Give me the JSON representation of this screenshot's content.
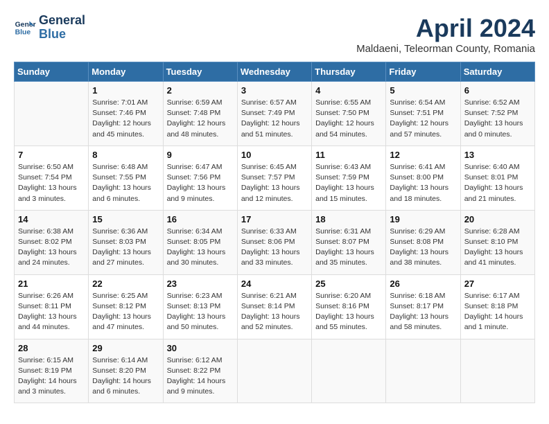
{
  "logo": {
    "line1": "General",
    "line2": "Blue"
  },
  "title": "April 2024",
  "subtitle": "Maldaeni, Teleorman County, Romania",
  "days_header": [
    "Sunday",
    "Monday",
    "Tuesday",
    "Wednesday",
    "Thursday",
    "Friday",
    "Saturday"
  ],
  "weeks": [
    [
      {
        "day": "",
        "info": ""
      },
      {
        "day": "1",
        "info": "Sunrise: 7:01 AM\nSunset: 7:46 PM\nDaylight: 12 hours\nand 45 minutes."
      },
      {
        "day": "2",
        "info": "Sunrise: 6:59 AM\nSunset: 7:48 PM\nDaylight: 12 hours\nand 48 minutes."
      },
      {
        "day": "3",
        "info": "Sunrise: 6:57 AM\nSunset: 7:49 PM\nDaylight: 12 hours\nand 51 minutes."
      },
      {
        "day": "4",
        "info": "Sunrise: 6:55 AM\nSunset: 7:50 PM\nDaylight: 12 hours\nand 54 minutes."
      },
      {
        "day": "5",
        "info": "Sunrise: 6:54 AM\nSunset: 7:51 PM\nDaylight: 12 hours\nand 57 minutes."
      },
      {
        "day": "6",
        "info": "Sunrise: 6:52 AM\nSunset: 7:52 PM\nDaylight: 13 hours\nand 0 minutes."
      }
    ],
    [
      {
        "day": "7",
        "info": "Sunrise: 6:50 AM\nSunset: 7:54 PM\nDaylight: 13 hours\nand 3 minutes."
      },
      {
        "day": "8",
        "info": "Sunrise: 6:48 AM\nSunset: 7:55 PM\nDaylight: 13 hours\nand 6 minutes."
      },
      {
        "day": "9",
        "info": "Sunrise: 6:47 AM\nSunset: 7:56 PM\nDaylight: 13 hours\nand 9 minutes."
      },
      {
        "day": "10",
        "info": "Sunrise: 6:45 AM\nSunset: 7:57 PM\nDaylight: 13 hours\nand 12 minutes."
      },
      {
        "day": "11",
        "info": "Sunrise: 6:43 AM\nSunset: 7:59 PM\nDaylight: 13 hours\nand 15 minutes."
      },
      {
        "day": "12",
        "info": "Sunrise: 6:41 AM\nSunset: 8:00 PM\nDaylight: 13 hours\nand 18 minutes."
      },
      {
        "day": "13",
        "info": "Sunrise: 6:40 AM\nSunset: 8:01 PM\nDaylight: 13 hours\nand 21 minutes."
      }
    ],
    [
      {
        "day": "14",
        "info": "Sunrise: 6:38 AM\nSunset: 8:02 PM\nDaylight: 13 hours\nand 24 minutes."
      },
      {
        "day": "15",
        "info": "Sunrise: 6:36 AM\nSunset: 8:03 PM\nDaylight: 13 hours\nand 27 minutes."
      },
      {
        "day": "16",
        "info": "Sunrise: 6:34 AM\nSunset: 8:05 PM\nDaylight: 13 hours\nand 30 minutes."
      },
      {
        "day": "17",
        "info": "Sunrise: 6:33 AM\nSunset: 8:06 PM\nDaylight: 13 hours\nand 33 minutes."
      },
      {
        "day": "18",
        "info": "Sunrise: 6:31 AM\nSunset: 8:07 PM\nDaylight: 13 hours\nand 35 minutes."
      },
      {
        "day": "19",
        "info": "Sunrise: 6:29 AM\nSunset: 8:08 PM\nDaylight: 13 hours\nand 38 minutes."
      },
      {
        "day": "20",
        "info": "Sunrise: 6:28 AM\nSunset: 8:10 PM\nDaylight: 13 hours\nand 41 minutes."
      }
    ],
    [
      {
        "day": "21",
        "info": "Sunrise: 6:26 AM\nSunset: 8:11 PM\nDaylight: 13 hours\nand 44 minutes."
      },
      {
        "day": "22",
        "info": "Sunrise: 6:25 AM\nSunset: 8:12 PM\nDaylight: 13 hours\nand 47 minutes."
      },
      {
        "day": "23",
        "info": "Sunrise: 6:23 AM\nSunset: 8:13 PM\nDaylight: 13 hours\nand 50 minutes."
      },
      {
        "day": "24",
        "info": "Sunrise: 6:21 AM\nSunset: 8:14 PM\nDaylight: 13 hours\nand 52 minutes."
      },
      {
        "day": "25",
        "info": "Sunrise: 6:20 AM\nSunset: 8:16 PM\nDaylight: 13 hours\nand 55 minutes."
      },
      {
        "day": "26",
        "info": "Sunrise: 6:18 AM\nSunset: 8:17 PM\nDaylight: 13 hours\nand 58 minutes."
      },
      {
        "day": "27",
        "info": "Sunrise: 6:17 AM\nSunset: 8:18 PM\nDaylight: 14 hours\nand 1 minute."
      }
    ],
    [
      {
        "day": "28",
        "info": "Sunrise: 6:15 AM\nSunset: 8:19 PM\nDaylight: 14 hours\nand 3 minutes."
      },
      {
        "day": "29",
        "info": "Sunrise: 6:14 AM\nSunset: 8:20 PM\nDaylight: 14 hours\nand 6 minutes."
      },
      {
        "day": "30",
        "info": "Sunrise: 6:12 AM\nSunset: 8:22 PM\nDaylight: 14 hours\nand 9 minutes."
      },
      {
        "day": "",
        "info": ""
      },
      {
        "day": "",
        "info": ""
      },
      {
        "day": "",
        "info": ""
      },
      {
        "day": "",
        "info": ""
      }
    ]
  ]
}
